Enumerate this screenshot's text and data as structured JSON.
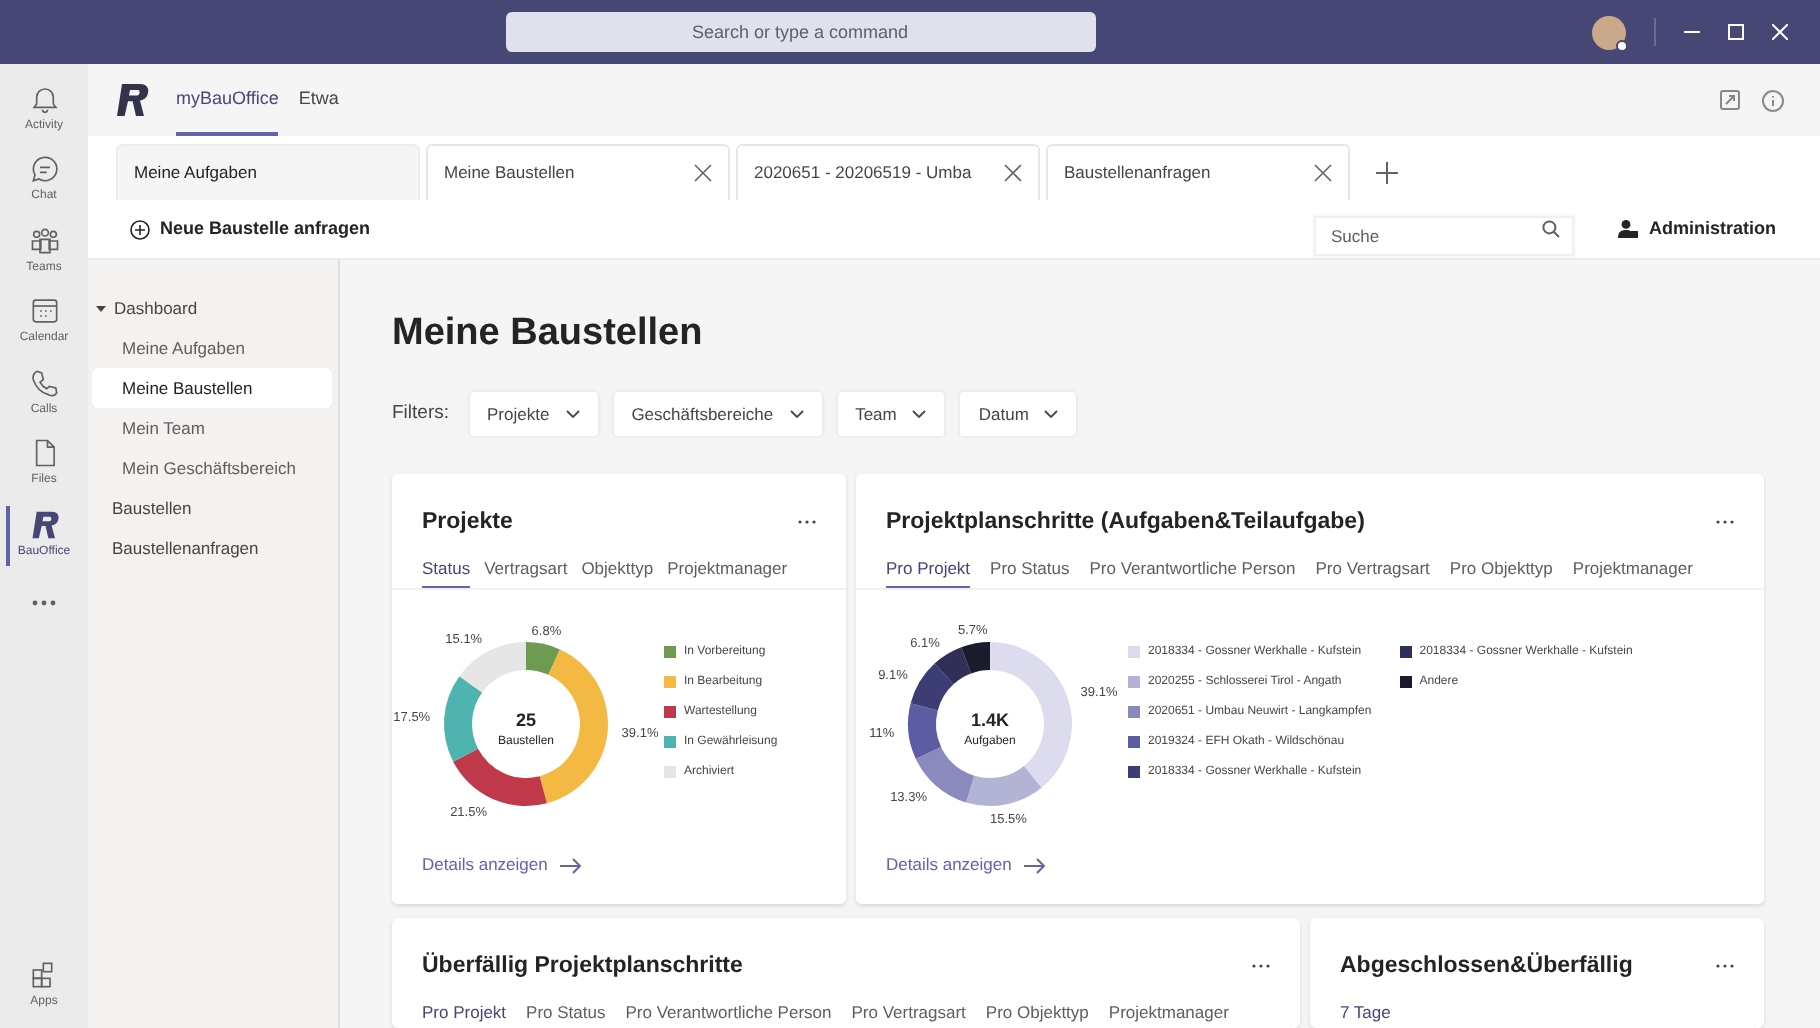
{
  "title_bar": {
    "search_placeholder": "Search or type a command"
  },
  "rail": {
    "items": [
      {
        "label": "Activity",
        "kind": "bell",
        "selected": false
      },
      {
        "label": "Chat",
        "kind": "chat",
        "selected": false
      },
      {
        "label": "Teams",
        "kind": "teams",
        "selected": false
      },
      {
        "label": "Calendar",
        "kind": "calendar",
        "selected": false
      },
      {
        "label": "Calls",
        "kind": "phone",
        "selected": false
      },
      {
        "label": "Files",
        "kind": "file",
        "selected": false
      },
      {
        "label": "BauOffice",
        "kind": "logo",
        "selected": true
      }
    ],
    "bottom": {
      "label": "Apps"
    }
  },
  "app_header": {
    "tabs": [
      {
        "label": "myBauOffice",
        "selected": true
      },
      {
        "label": "Etwa",
        "selected": false
      }
    ]
  },
  "page_tabs": [
    {
      "label": "Meine Aufgaben",
      "closable": false
    },
    {
      "label": "Meine Baustellen",
      "closable": true
    },
    {
      "label": "2020651 - 20206519 - Umba",
      "closable": true
    },
    {
      "label": "Baustellenanfragen",
      "closable": true
    }
  ],
  "toolbar": {
    "new_button": "Neue Baustelle anfragen",
    "search_placeholder": "Suche",
    "admin_button": "Administration"
  },
  "sidebar": {
    "items": [
      {
        "label": "Dashboard",
        "expanded": true,
        "selected": false,
        "children": [
          {
            "label": "Meine Aufgaben",
            "selected": false
          },
          {
            "label": "Meine Baustellen",
            "selected": true
          },
          {
            "label": "Mein Team",
            "selected": false
          },
          {
            "label": "Mein Geschäftsbereich",
            "selected": false
          }
        ]
      },
      {
        "label": "Baustellen",
        "selected": false
      },
      {
        "label": "Baustellenanfragen",
        "selected": false
      }
    ]
  },
  "page_title": "Meine Baustellen",
  "filters": {
    "label": "Filters:",
    "items": [
      "Projekte",
      "Geschäftsbereiche",
      "Team",
      "Datum"
    ]
  },
  "cards": [
    {
      "title": "Projekte",
      "tabs": [
        {
          "label": "Status",
          "selected": true
        },
        {
          "label": "Vertragsart",
          "selected": false
        },
        {
          "label": "Objekttyp",
          "selected": false
        },
        {
          "label": "Projektmanager",
          "selected": false
        }
      ],
      "center_value": "25",
      "center_label": "Baustellen",
      "link": "Details anzeigen",
      "chart_data": {
        "type": "donut",
        "categories": [
          "In Vorbereitung",
          "In Bearbeitung",
          "Wartestellung",
          "In Gewährleisung",
          "Archiviert"
        ],
        "series": [
          {
            "values": [
              6.8,
              39.1,
              21.5,
              17.5,
              15.1
            ]
          }
        ],
        "colors": [
          "#6e9a52",
          "#f4b942",
          "#c0394b",
          "#4fb3b0",
          "#e6e6e6"
        ],
        "value_labels": [
          "6.8%",
          "39.1%",
          "21.5%",
          "17.5%",
          "15.1%"
        ]
      }
    },
    {
      "title": "Projektplanschritte (Aufgaben&Teilaufgabe)",
      "tabs": [
        {
          "label": "Pro Projekt",
          "selected": true
        },
        {
          "label": "Pro Status",
          "selected": false
        },
        {
          "label": "Pro Verantwortliche Person",
          "selected": false
        },
        {
          "label": "Pro Vertragsart",
          "selected": false
        },
        {
          "label": "Pro Objekttyp",
          "selected": false
        },
        {
          "label": "Projektmanager",
          "selected": false
        }
      ],
      "center_value": "1.4K",
      "center_label": "Aufgaben",
      "link": "Details anzeigen",
      "chart_data": {
        "type": "donut",
        "categories": [
          "2018334 - Gossner Werkhalle - Kufstein",
          "2020255 - Schlosserei Tirol - Angath",
          "2020651 - Umbau Neuwirt - Langkampfen",
          "2019324 - EFH Okath - Wildschönau",
          "2018334 - Gossner Werkhalle - Kufstein",
          "2018334 - Gossner Werkhalle - Kufstein",
          "Andere"
        ],
        "series": [
          {
            "values": [
              39.1,
              15.5,
              13.3,
              11,
              9.1,
              6.1,
              5.7
            ]
          }
        ],
        "colors": [
          "#dcdcee",
          "#b3b3d6",
          "#8a8abf",
          "#5b5ca3",
          "#3c3d74",
          "#2f3059",
          "#1b1b2e"
        ],
        "value_labels": [
          "39.1%",
          "15.5%",
          "13.3%",
          "11%",
          "9.1%",
          "6.1%",
          "5.7%"
        ]
      }
    },
    {
      "title": "Überfällig Projektplanschritte",
      "tabs": [
        {
          "label": "Pro Projekt",
          "selected": true
        },
        {
          "label": "Pro Status",
          "selected": false
        },
        {
          "label": "Pro Verantwortliche Person",
          "selected": false
        },
        {
          "label": "Pro Vertragsart",
          "selected": false
        },
        {
          "label": "Pro Objekttyp",
          "selected": false
        },
        {
          "label": "Projektmanager",
          "selected": false
        }
      ]
    },
    {
      "title": "Abgeschlossen&Überfällig",
      "tabs": [
        {
          "label": "7 Tage",
          "selected": true
        }
      ]
    }
  ]
}
